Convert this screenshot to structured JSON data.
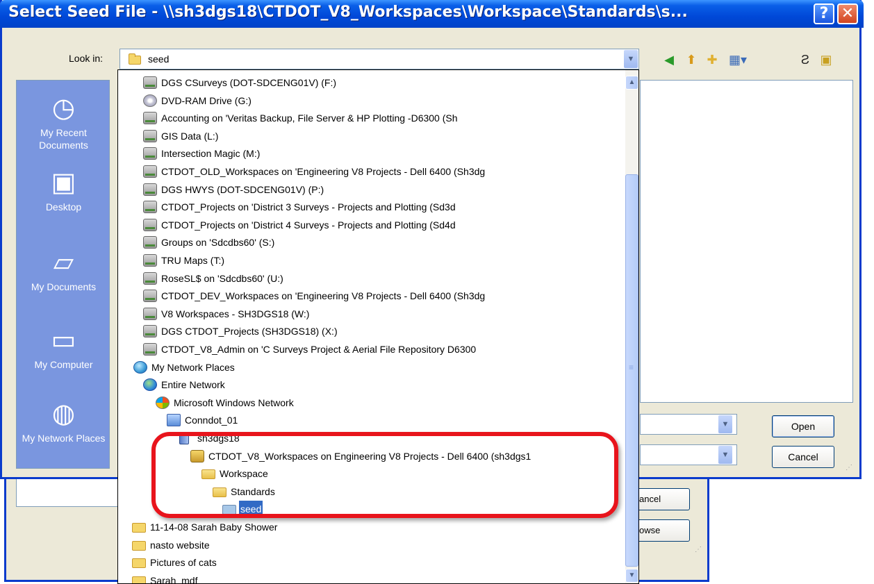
{
  "window": {
    "title": "Select Seed File - \\\\sh3dgs18\\CTDOT_V8_Workspaces\\Workspace\\Standards\\s...",
    "help_glyph": "?",
    "close_glyph": "✕"
  },
  "lookin": {
    "label": "Look in:",
    "value": "seed"
  },
  "toolbar": {
    "icons": [
      "back-icon",
      "up-folder-icon",
      "new-folder-icon",
      "view-menu-icon",
      "refresh-icon",
      "config-icon"
    ]
  },
  "places": [
    {
      "label": "My Recent Documents",
      "icon": "recent-documents-icon"
    },
    {
      "label": "Desktop",
      "icon": "desktop-icon"
    },
    {
      "label": "My Documents",
      "icon": "my-documents-icon"
    },
    {
      "label": "My Computer",
      "icon": "my-computer-icon"
    },
    {
      "label": "My Network Places",
      "icon": "network-places-icon"
    }
  ],
  "buttons": {
    "open": "Open",
    "cancel": "Cancel"
  },
  "background_dialog": {
    "cancel_partial": "ancel",
    "browse_partial": "owse"
  },
  "dropdown_items": [
    {
      "label": "DGS CSurveys (DOT-SDCENG01V) (F:)",
      "icon": "network-drive-icon"
    },
    {
      "label": "DVD-RAM Drive (G:)",
      "icon": "dvd-drive-icon"
    },
    {
      "label": "Accounting on 'Veritas Backup, File Server & HP Plotting -D6300 (Sh",
      "icon": "network-drive-icon"
    },
    {
      "label": "GIS Data (L:)",
      "icon": "network-drive-icon"
    },
    {
      "label": "Intersection Magic (M:)",
      "icon": "network-drive-icon"
    },
    {
      "label": "CTDOT_OLD_Workspaces on 'Engineering V8 Projects - Dell 6400 (Sh3dg",
      "icon": "network-drive-icon"
    },
    {
      "label": "DGS HWYS (DOT-SDCENG01V) (P:)",
      "icon": "network-drive-icon"
    },
    {
      "label": "CTDOT_Projects on 'District 3 Surveys - Projects and Plotting (Sd3d",
      "icon": "network-drive-icon"
    },
    {
      "label": "CTDOT_Projects on 'District 4 Surveys - Projects and Plotting (Sd4d",
      "icon": "network-drive-icon"
    },
    {
      "label": "Groups on 'Sdcdbs60' (S:)",
      "icon": "network-drive-icon"
    },
    {
      "label": "TRU Maps (T:)",
      "icon": "network-drive-icon"
    },
    {
      "label": "RoseSL$ on 'Sdcdbs60' (U:)",
      "icon": "network-drive-icon"
    },
    {
      "label": "CTDOT_DEV_Workspaces on 'Engineering V8 Projects - Dell 6400 (Sh3dg",
      "icon": "network-drive-icon"
    },
    {
      "label": "V8 Workspaces - SH3DGS18 (W:)",
      "icon": "network-drive-icon"
    },
    {
      "label": "DGS CTDOT_Projects (SH3DGS18) (X:)",
      "icon": "network-drive-icon"
    },
    {
      "label": "CTDOT_V8_Admin on 'C Surveys Project & Aerial File Repository D6300",
      "icon": "network-drive-icon"
    },
    {
      "label": "My Network Places",
      "icon": "network-places-icon"
    },
    {
      "label": "Entire Network",
      "icon": "entire-network-icon"
    },
    {
      "label": "Microsoft Windows Network",
      "icon": "windows-network-icon"
    },
    {
      "label": "Conndot_01",
      "icon": "domain-icon"
    },
    {
      "label": "sh3dgs18",
      "icon": "server-icon"
    },
    {
      "label": "CTDOT_V8_Workspaces on Engineering V8 Projects - Dell 6400 (sh3dgs1",
      "icon": "share-icon"
    },
    {
      "label": "Workspace",
      "icon": "folder-open-icon"
    },
    {
      "label": "Standards",
      "icon": "folder-open-icon"
    },
    {
      "label": "seed",
      "icon": "folder-selected-icon"
    },
    {
      "label": "11-14-08 Sarah Baby Shower",
      "icon": "folder-icon"
    },
    {
      "label": "nasto website",
      "icon": "folder-icon"
    },
    {
      "label": "Pictures of cats",
      "icon": "folder-icon"
    },
    {
      "label": "Sarah_mdf",
      "icon": "folder-icon"
    }
  ]
}
